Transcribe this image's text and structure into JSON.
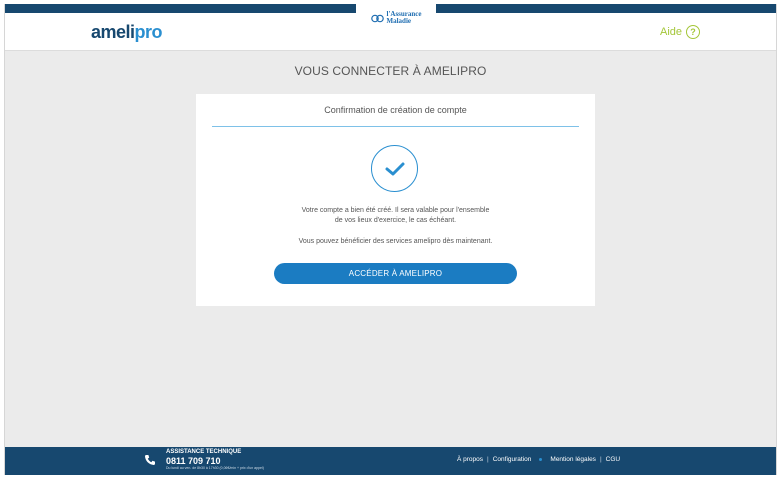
{
  "header": {
    "logo_part1": "ameli",
    "logo_part2": "pro",
    "brand_line1": "l'Assurance",
    "brand_line2": "Maladie",
    "help_label": "Aide",
    "help_symbol": "?"
  },
  "page_title": "VOUS CONNECTER À AMELIPRO",
  "card": {
    "title": "Confirmation de création de compte",
    "message_line1": "Votre compte a bien été créé. Il sera valable pour l'ensemble",
    "message_line2": "de vos lieux d'exercice, le cas échéant.",
    "message_services": "Vous pouvez bénéficier des services amelipro dès maintenant.",
    "button_label": "ACCÉDER À AMELIPRO"
  },
  "footer": {
    "assist_title": "ASSISTANCE TECHNIQUE",
    "phone": "0811 709 710",
    "hours": "Du lundi au ven. de 8h30 à 17h30 (0,06€/min + prix d'un appel)",
    "links": [
      "À propos",
      "Configuration",
      "Mention légales",
      "CGU"
    ]
  },
  "colors": {
    "primary": "#17486f",
    "accent": "#2a8fd0",
    "button": "#1b7cc2",
    "help": "#a4c639",
    "background": "#ebebeb"
  }
}
